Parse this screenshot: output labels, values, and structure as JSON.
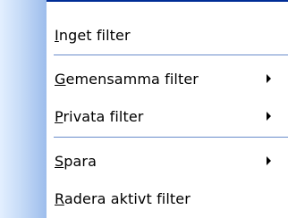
{
  "menu": {
    "items": [
      {
        "mnemonic": "I",
        "rest": "nget filter",
        "submenu": false
      },
      {
        "mnemonic": "G",
        "rest": "emensamma filter",
        "submenu": true
      },
      {
        "mnemonic": "P",
        "rest": "rivata filter",
        "submenu": true
      },
      {
        "mnemonic": "S",
        "rest": "para",
        "submenu": true
      },
      {
        "mnemonic": "R",
        "rest": "adera aktivt filter",
        "submenu": false
      }
    ]
  },
  "colors": {
    "border": "#002d96",
    "separator": "#6a8ccb",
    "gutter_light": "#e3efff",
    "gutter_dark": "#9dbdec"
  },
  "icons": {
    "submenu": "submenu-arrow-icon"
  }
}
